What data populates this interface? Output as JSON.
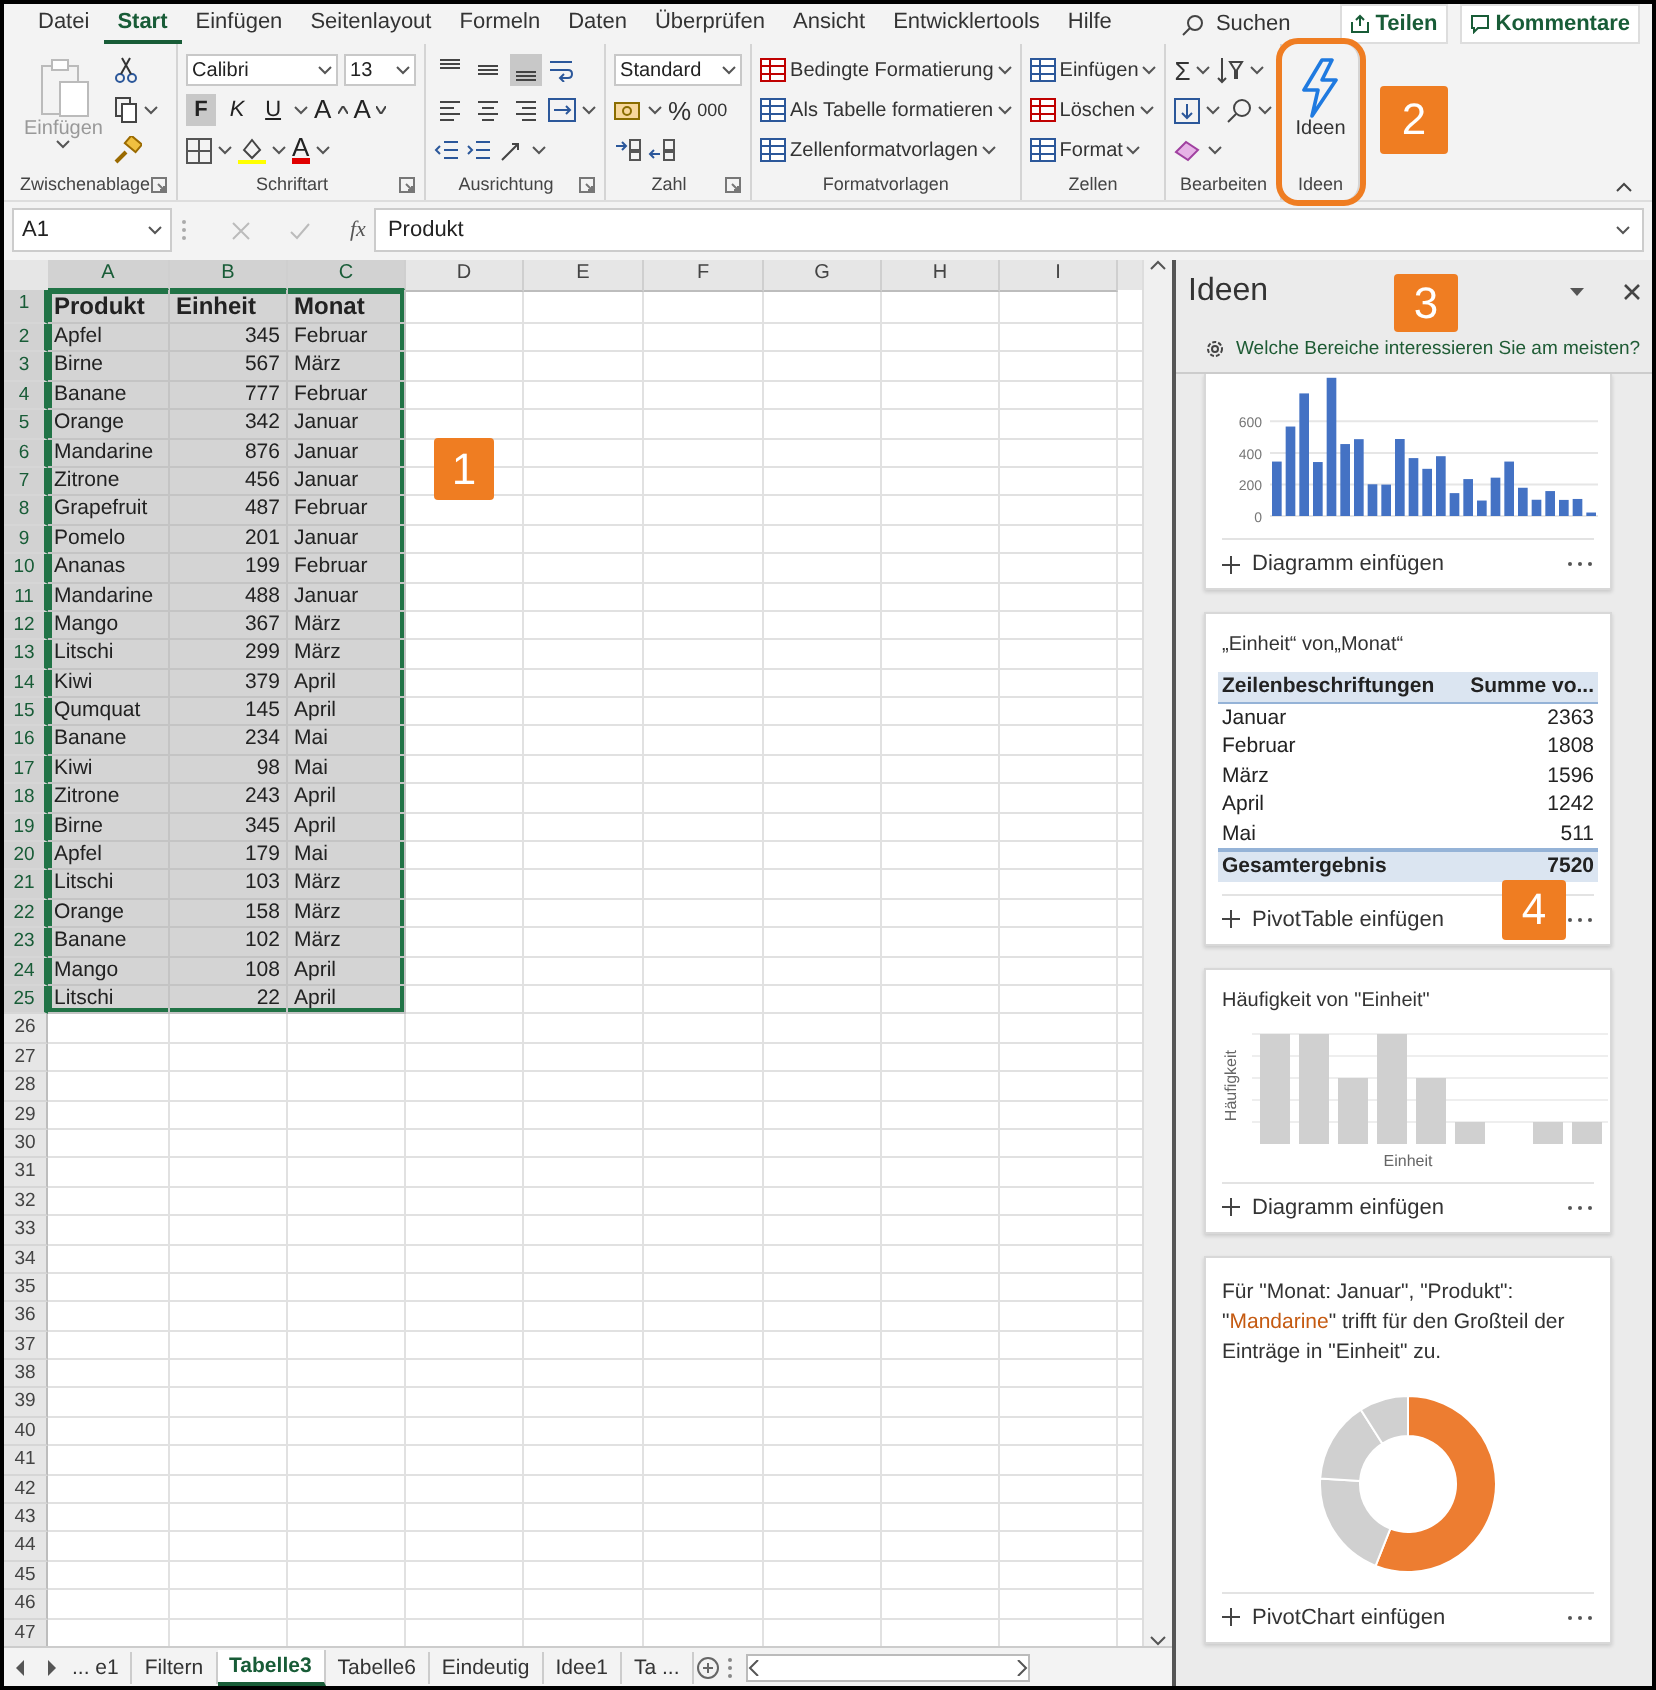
{
  "ribbon_tabs": [
    {
      "label": "Datei",
      "selected": false
    },
    {
      "label": "Start",
      "selected": true
    },
    {
      "label": "Einfügen",
      "selected": false
    },
    {
      "label": "Seitenlayout",
      "selected": false
    },
    {
      "label": "Formeln",
      "selected": false
    },
    {
      "label": "Daten",
      "selected": false
    },
    {
      "label": "Überprüfen",
      "selected": false
    },
    {
      "label": "Ansicht",
      "selected": false
    },
    {
      "label": "Entwicklertools",
      "selected": false
    },
    {
      "label": "Hilfe",
      "selected": false
    }
  ],
  "search": {
    "label": "Suchen"
  },
  "share_button": "Teilen",
  "comments_button": "Kommentare",
  "ribbon_groups": [
    {
      "kind": "clipboard",
      "label": "Zwischenablage",
      "launcher": true,
      "paste_label": "Einfügen",
      "paste_disabled": true
    },
    {
      "kind": "font",
      "label": "Schriftart",
      "launcher": true,
      "font_name": "Calibri",
      "font_size": "13",
      "styles": [
        {
          "label": "F",
          "selected": true
        },
        {
          "label": "K",
          "selected": false
        },
        {
          "label": "U",
          "selected": false
        }
      ],
      "grow_label": "A",
      "shrink_label": "A",
      "color_label": "A"
    },
    {
      "kind": "alignment",
      "label": "Ausrichtung",
      "launcher": true,
      "vertical_align": [
        {
          "selected": false
        },
        {
          "selected": false
        },
        {
          "selected": true
        }
      ],
      "horizontal_align": [
        {
          "selected": false
        },
        {
          "selected": false
        },
        {
          "selected": false
        }
      ]
    },
    {
      "kind": "number",
      "label": "Zahl",
      "launcher": true,
      "format": "Standard",
      "percent": "%",
      "thousands": "000"
    },
    {
      "kind": "styles",
      "label": "Formatvorlagen",
      "launcher": false,
      "items": [
        "Bedingte Formatierung",
        "Als Tabelle formatieren",
        "Zellenformatvorlagen"
      ]
    },
    {
      "kind": "cells",
      "label": "Zellen",
      "launcher": false,
      "items": [
        "Einfügen",
        "Löschen",
        "Format"
      ]
    },
    {
      "kind": "editing",
      "label": "Bearbeiten",
      "launcher": false,
      "sum": "Σ"
    },
    {
      "kind": "ideas",
      "label": "Ideen",
      "launcher": false,
      "button_label": "Ideen",
      "highlighted": true
    }
  ],
  "formula_bar": {
    "name_box": "A1",
    "function_label": "fx",
    "value": "Produkt"
  },
  "sheet": {
    "columns": [
      {
        "label": "A",
        "selected": true,
        "kind": "text"
      },
      {
        "label": "B",
        "selected": true,
        "kind": "number"
      },
      {
        "label": "C",
        "selected": true,
        "kind": "text"
      },
      {
        "label": "D",
        "selected": false
      },
      {
        "label": "E",
        "selected": false
      },
      {
        "label": "F",
        "selected": false
      },
      {
        "label": "G",
        "selected": false
      },
      {
        "label": "H",
        "selected": false
      },
      {
        "label": "I",
        "selected": false
      }
    ],
    "rows": [
      {
        "header": "1",
        "selected": true,
        "kind": "header",
        "cells": [
          "Produkt",
          "Einheit",
          "Monat"
        ]
      },
      {
        "header": "2",
        "selected": true,
        "kind": "data",
        "cells": [
          "Apfel",
          "345",
          "Februar"
        ]
      },
      {
        "header": "3",
        "selected": true,
        "kind": "data",
        "cells": [
          "Birne",
          "567",
          "März"
        ]
      },
      {
        "header": "4",
        "selected": true,
        "kind": "data",
        "cells": [
          "Banane",
          "777",
          "Februar"
        ]
      },
      {
        "header": "5",
        "selected": true,
        "kind": "data",
        "cells": [
          "Orange",
          "342",
          "Januar"
        ]
      },
      {
        "header": "6",
        "selected": true,
        "kind": "data",
        "cells": [
          "Mandarine",
          "876",
          "Januar"
        ]
      },
      {
        "header": "7",
        "selected": true,
        "kind": "data",
        "cells": [
          "Zitrone",
          "456",
          "Januar"
        ]
      },
      {
        "header": "8",
        "selected": true,
        "kind": "data",
        "cells": [
          "Grapefruit",
          "487",
          "Februar"
        ]
      },
      {
        "header": "9",
        "selected": true,
        "kind": "data",
        "cells": [
          "Pomelo",
          "201",
          "Januar"
        ]
      },
      {
        "header": "10",
        "selected": true,
        "kind": "data",
        "cells": [
          "Ananas",
          "199",
          "Februar"
        ]
      },
      {
        "header": "11",
        "selected": true,
        "kind": "data",
        "cells": [
          "Mandarine",
          "488",
          "Januar"
        ]
      },
      {
        "header": "12",
        "selected": true,
        "kind": "data",
        "cells": [
          "Mango",
          "367",
          "März"
        ]
      },
      {
        "header": "13",
        "selected": true,
        "kind": "data",
        "cells": [
          "Litschi",
          "299",
          "März"
        ]
      },
      {
        "header": "14",
        "selected": true,
        "kind": "data",
        "cells": [
          "Kiwi",
          "379",
          "April"
        ]
      },
      {
        "header": "15",
        "selected": true,
        "kind": "data",
        "cells": [
          "Qumquat",
          "145",
          "April"
        ]
      },
      {
        "header": "16",
        "selected": true,
        "kind": "data",
        "cells": [
          "Banane",
          "234",
          "Mai"
        ]
      },
      {
        "header": "17",
        "selected": true,
        "kind": "data",
        "cells": [
          "Kiwi",
          "98",
          "Mai"
        ]
      },
      {
        "header": "18",
        "selected": true,
        "kind": "data",
        "cells": [
          "Zitrone",
          "243",
          "April"
        ]
      },
      {
        "header": "19",
        "selected": true,
        "kind": "data",
        "cells": [
          "Birne",
          "345",
          "April"
        ]
      },
      {
        "header": "20",
        "selected": true,
        "kind": "data",
        "cells": [
          "Apfel",
          "179",
          "Mai"
        ]
      },
      {
        "header": "21",
        "selected": true,
        "kind": "data",
        "cells": [
          "Litschi",
          "103",
          "März"
        ]
      },
      {
        "header": "22",
        "selected": true,
        "kind": "data",
        "cells": [
          "Orange",
          "158",
          "März"
        ]
      },
      {
        "header": "23",
        "selected": true,
        "kind": "data",
        "cells": [
          "Banane",
          "102",
          "März"
        ]
      },
      {
        "header": "24",
        "selected": true,
        "kind": "data",
        "cells": [
          "Mango",
          "108",
          "April"
        ]
      },
      {
        "header": "25",
        "selected": true,
        "kind": "data",
        "cells": [
          "Litschi",
          "22",
          "April"
        ]
      },
      {
        "header": "26",
        "selected": false
      },
      {
        "header": "27",
        "selected": false
      },
      {
        "header": "28",
        "selected": false
      },
      {
        "header": "29",
        "selected": false
      },
      {
        "header": "30",
        "selected": false
      },
      {
        "header": "31",
        "selected": false
      },
      {
        "header": "32",
        "selected": false
      },
      {
        "header": "33",
        "selected": false
      },
      {
        "header": "34",
        "selected": false
      },
      {
        "header": "35",
        "selected": false
      },
      {
        "header": "36",
        "selected": false
      },
      {
        "header": "37",
        "selected": false
      },
      {
        "header": "38",
        "selected": false
      },
      {
        "header": "39",
        "selected": false
      },
      {
        "header": "40",
        "selected": false
      },
      {
        "header": "41",
        "selected": false
      },
      {
        "header": "42",
        "selected": false
      },
      {
        "header": "43",
        "selected": false
      },
      {
        "header": "44",
        "selected": false
      },
      {
        "header": "45",
        "selected": false
      },
      {
        "header": "46",
        "selected": false
      },
      {
        "header": "47",
        "selected": false
      }
    ]
  },
  "sheet_tabs": [
    {
      "label": "... e1",
      "selected": false
    },
    {
      "label": "Filtern",
      "selected": false
    },
    {
      "label": "Tabelle3",
      "selected": true
    },
    {
      "label": "Tabelle6",
      "selected": false
    },
    {
      "label": "Eindeutig",
      "selected": false
    },
    {
      "label": "Idee1",
      "selected": false
    },
    {
      "label": "Ta ...",
      "selected": false
    }
  ],
  "ideas_pane": {
    "title": "Ideen",
    "prompt": "Welche Bereiche interessieren Sie am meisten?",
    "cards": [
      {
        "kind": "bar_chart",
        "action": "Diagramm einfügen",
        "chart_data": {
          "type": "bar",
          "values": [
            345,
            567,
            777,
            342,
            876,
            456,
            487,
            201,
            199,
            488,
            367,
            299,
            379,
            145,
            234,
            98,
            243,
            345,
            179,
            103,
            158,
            102,
            108,
            22
          ],
          "ylim": [
            0,
            900
          ],
          "yticks": [
            0,
            200,
            400,
            600
          ],
          "grid": true
        }
      },
      {
        "kind": "pivot_table",
        "title": "„Einheit“ von„Monat“",
        "columns": [
          "Zeilenbeschriftungen",
          "Summe vo..."
        ],
        "rows": [
          [
            "Januar",
            "2363"
          ],
          [
            "Februar",
            "1808"
          ],
          [
            "März",
            "1596"
          ],
          [
            "April",
            "1242"
          ],
          [
            "Mai",
            "511"
          ]
        ],
        "total": [
          "Gesamtergebnis",
          "7520"
        ],
        "action": "PivotTable einfügen"
      },
      {
        "kind": "histogram",
        "title": "Häufigkeit von \"Einheit\"",
        "ylabel": "Häufigkeit",
        "xlabel": "Einheit",
        "action": "Diagramm einfügen"
      },
      {
        "kind": "donut",
        "parts": [
          {
            "text": "Für \"Monat: Januar\", \"Produkt\": \"",
            "highlight": false
          },
          {
            "text": "Mandarine",
            "highlight": true
          },
          {
            "text": "\" trifft für den Großteil der Einträge in \"Einheit\" zu.",
            "highlight": false
          }
        ],
        "action": "PivotChart einfügen"
      }
    ]
  },
  "callouts": [
    {
      "label": "1"
    },
    {
      "label": "2"
    },
    {
      "label": "3"
    },
    {
      "label": "4"
    }
  ]
}
